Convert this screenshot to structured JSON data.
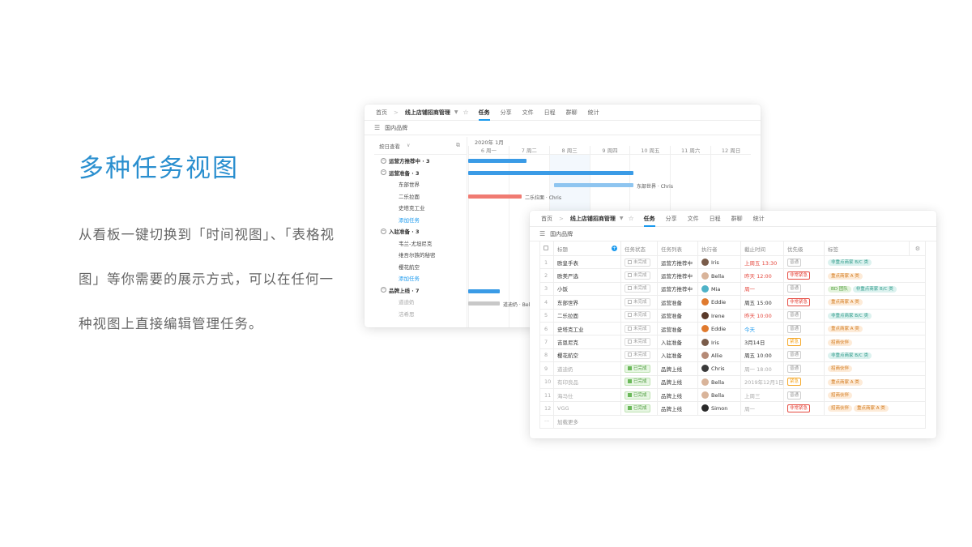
{
  "hero": {
    "title": "多种任务视图",
    "description": "从看板一键切换到「时间视图」、「表格视图」等你需要的展示方式，可以在任何一种视图上直接编辑管理任务。"
  },
  "nav": {
    "home": "首页",
    "separator": ">",
    "project": "线上店铺招商管理",
    "tabs": [
      "任务",
      "分享",
      "文件",
      "日程",
      "群聊",
      "统计"
    ],
    "active_tab": "任务"
  },
  "list_name": "国内品牌",
  "gantt": {
    "view_selector": "按日查看",
    "month": "2020年 1月",
    "days": [
      "6 周一",
      "7 周二",
      "8 周三",
      "9 周四",
      "10 周五",
      "11 周六",
      "12 周日"
    ],
    "rows": [
      {
        "kind": "group",
        "text": "运营方推荐中 · 3"
      },
      {
        "kind": "group",
        "text": "运营准备 · 3"
      },
      {
        "kind": "task",
        "text": "东部世界"
      },
      {
        "kind": "task",
        "text": "二乐拉面"
      },
      {
        "kind": "task",
        "text": "史塔克工业"
      },
      {
        "kind": "add",
        "text": "添加任务"
      },
      {
        "kind": "group",
        "text": "入驻准备 · 3"
      },
      {
        "kind": "task",
        "text": "韦兰-尤坦尼克"
      },
      {
        "kind": "task",
        "text": "维吾尔族的秘密"
      },
      {
        "kind": "task",
        "text": "樱花航空"
      },
      {
        "kind": "add",
        "text": "添加任务"
      },
      {
        "kind": "group",
        "text": "品牌上线 · 7"
      },
      {
        "kind": "done",
        "text": "道迪奶"
      },
      {
        "kind": "done",
        "text": "洁希思"
      }
    ],
    "bar_labels": [
      "东部世界 · Chris",
      "二乐拉面 · Chris",
      "道迪奶 · Bella"
    ],
    "colors": {
      "blue": "#3a9be6",
      "light_blue": "#8ec5f0",
      "red": "#f07b72",
      "grey": "#c8c8c8"
    }
  },
  "table": {
    "headers": [
      "标题",
      "任务状态",
      "任务列表",
      "执行者",
      "截止时间",
      "优先级",
      "标签"
    ],
    "rows": [
      {
        "idx": "1",
        "title": "欧皇手表",
        "status": "未完成",
        "list": "运营方推荐中",
        "assignee": "Iris",
        "avatar": "#7a5c4a",
        "due": "上周五 13:30",
        "due_style": "red",
        "priority": "普通",
        "prio_style": "normal",
        "tags": [
          {
            "text": "非重点商家 B/C 类",
            "style": "teal"
          }
        ]
      },
      {
        "idx": "2",
        "title": "欧美严选",
        "status": "未完成",
        "list": "运营方推荐中",
        "assignee": "Bella",
        "avatar": "#d9b49a",
        "due": "昨天 12:00",
        "due_style": "red",
        "priority": "非常紧急",
        "prio_style": "urgent",
        "tags": [
          {
            "text": "重点商家 A 类",
            "style": "orange"
          }
        ]
      },
      {
        "idx": "3",
        "title": "小饭",
        "status": "未完成",
        "list": "运营方推荐中",
        "assignee": "Mia",
        "avatar": "#4fb3c8",
        "due": "周一",
        "due_style": "red",
        "priority": "普通",
        "prio_style": "normal",
        "tags": [
          {
            "text": "BD 团队",
            "style": "green"
          },
          {
            "text": "非重点商家 B/C 类",
            "style": "teal"
          }
        ]
      },
      {
        "idx": "4",
        "title": "东部世界",
        "status": "未完成",
        "list": "运营准备",
        "assignee": "Eddie",
        "avatar": "#e07a2e",
        "due": "周五 15:00",
        "due_style": "normal",
        "priority": "非常紧急",
        "prio_style": "urgent",
        "tags": [
          {
            "text": "重点商家 A 类",
            "style": "orange"
          }
        ]
      },
      {
        "idx": "5",
        "title": "二乐拉面",
        "status": "未完成",
        "list": "运营准备",
        "assignee": "Irene",
        "avatar": "#5a3a2a",
        "due": "昨天 10:00",
        "due_style": "red",
        "priority": "普通",
        "prio_style": "normal",
        "tags": [
          {
            "text": "非重点商家 B/C 类",
            "style": "teal"
          }
        ]
      },
      {
        "idx": "6",
        "title": "史塔克工业",
        "status": "未完成",
        "list": "运营准备",
        "assignee": "Eddie",
        "avatar": "#e07a2e",
        "due": "今天",
        "due_style": "blue",
        "priority": "普通",
        "prio_style": "normal",
        "tags": [
          {
            "text": "重点商家 A 类",
            "style": "orange"
          }
        ]
      },
      {
        "idx": "7",
        "title": "吉恩尼克",
        "status": "未完成",
        "list": "入驻准备",
        "assignee": "Iris",
        "avatar": "#7a5c4a",
        "due": "3月14日",
        "due_style": "normal",
        "priority": "紧急",
        "prio_style": "high",
        "tags": [
          {
            "text": "招商伙伴",
            "style": "orange"
          }
        ]
      },
      {
        "idx": "8",
        "title": "樱花航空",
        "status": "未完成",
        "list": "入驻准备",
        "assignee": "Allie",
        "avatar": "#b58a76",
        "due": "周五 10:00",
        "due_style": "normal",
        "priority": "普通",
        "prio_style": "normal",
        "tags": [
          {
            "text": "非重点商家 B/C 类",
            "style": "teal"
          }
        ]
      },
      {
        "idx": "9",
        "title": "道迪奶",
        "status": "已完成",
        "list": "品牌上线",
        "assignee": "Chris",
        "avatar": "#3a3a3a",
        "due": "周一 18:00",
        "due_style": "grey",
        "priority": "普通",
        "prio_style": "normal",
        "tags": [
          {
            "text": "招商伙伴",
            "style": "orange"
          }
        ]
      },
      {
        "idx": "10",
        "title": "有印良品",
        "status": "已完成",
        "list": "品牌上线",
        "assignee": "Bella",
        "avatar": "#d9b49a",
        "due": "2019年12月1日",
        "due_style": "grey",
        "priority": "紧急",
        "prio_style": "high",
        "tags": [
          {
            "text": "重点商家 A 类",
            "style": "orange"
          }
        ]
      },
      {
        "idx": "11",
        "title": "海马仕",
        "status": "已完成",
        "list": "品牌上线",
        "assignee": "Bella",
        "avatar": "#d9b49a",
        "due": "上周三",
        "due_style": "grey",
        "priority": "普通",
        "prio_style": "normal",
        "tags": [
          {
            "text": "招商伙伴",
            "style": "orange"
          }
        ]
      },
      {
        "idx": "12",
        "title": "VGG",
        "status": "已完成",
        "list": "品牌上线",
        "assignee": "Simon",
        "avatar": "#2a2a2a",
        "due": "周一",
        "due_style": "grey",
        "priority": "非常紧急",
        "prio_style": "urgent",
        "tags": [
          {
            "text": "招商伙伴",
            "style": "orange"
          },
          {
            "text": "重点商家 A 类",
            "style": "orange"
          }
        ]
      }
    ],
    "load_more": "加载更多",
    "load_more_icon": "···"
  }
}
